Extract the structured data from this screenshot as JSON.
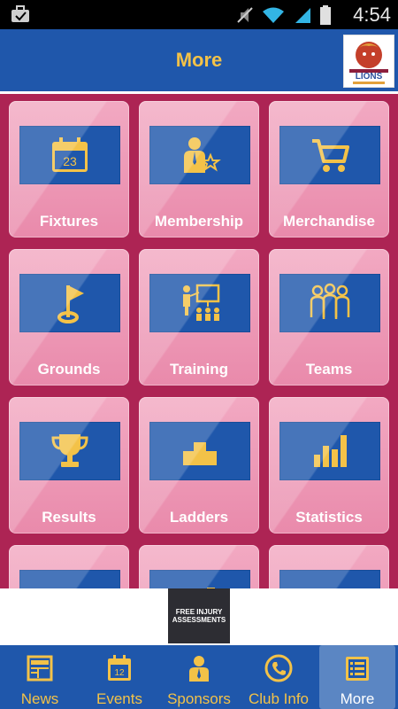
{
  "status": {
    "time": "4:54"
  },
  "header": {
    "title": "More",
    "logo_text": "LIONS"
  },
  "tiles": [
    {
      "label": "Fixtures",
      "icon": "calendar-icon",
      "day": "23"
    },
    {
      "label": "Membership",
      "icon": "member-icon"
    },
    {
      "label": "Merchandise",
      "icon": "cart-icon"
    },
    {
      "label": "Grounds",
      "icon": "flag-icon"
    },
    {
      "label": "Training",
      "icon": "training-icon"
    },
    {
      "label": "Teams",
      "icon": "team-icon"
    },
    {
      "label": "Results",
      "icon": "trophy-icon"
    },
    {
      "label": "Ladders",
      "icon": "podium-icon"
    },
    {
      "label": "Statistics",
      "icon": "bar-chart-icon"
    }
  ],
  "banner": {
    "line1": "FREE INJURY",
    "line2": "ASSESSMENTS"
  },
  "tabs": [
    {
      "label": "News",
      "icon": "news-icon"
    },
    {
      "label": "Events",
      "icon": "calendar-icon",
      "day": "12"
    },
    {
      "label": "Sponsors",
      "icon": "person-icon"
    },
    {
      "label": "Club Info",
      "icon": "phone-icon"
    },
    {
      "label": "More",
      "icon": "list-icon",
      "active": true
    }
  ],
  "colors": {
    "header_blue": "#1f57ab",
    "accent_gold": "#f3c248",
    "maroon": "#ad2454",
    "tile_pink": "#ec93b2"
  }
}
